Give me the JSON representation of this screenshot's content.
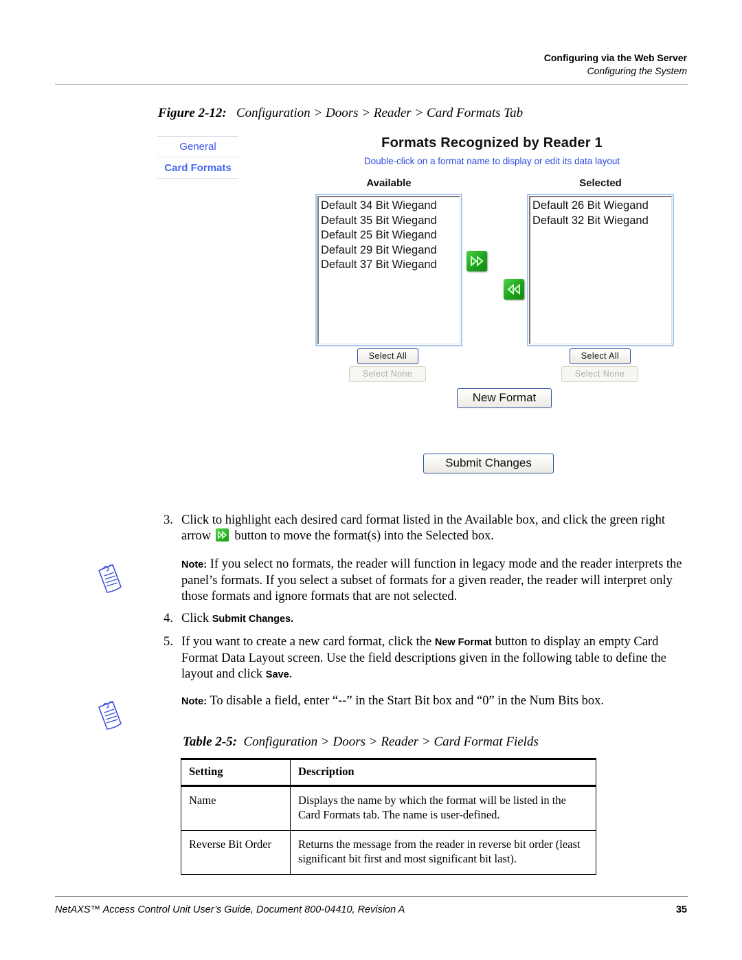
{
  "header": {
    "section": "Configuring via the Web Server",
    "subsection": "Configuring the System"
  },
  "figure": {
    "label": "Figure 2-12:",
    "caption": "Configuration > Doors > Reader > Card Formats Tab"
  },
  "screenshot": {
    "tabs": [
      {
        "label": "General",
        "active": false
      },
      {
        "label": "Card Formats",
        "active": true
      }
    ],
    "title": "Formats Recognized by Reader 1",
    "hint": "Double-click on a format name to display or edit its data layout",
    "available": {
      "heading": "Available",
      "items": [
        "Default 34 Bit Wiegand",
        "Default 35 Bit Wiegand",
        "Default 25 Bit Wiegand",
        "Default 29 Bit Wiegand",
        "Default 37 Bit Wiegand"
      ],
      "select_all": "Select All",
      "select_none": "Select None"
    },
    "selected": {
      "heading": "Selected",
      "items": [
        "Default 26 Bit Wiegand",
        "Default 32 Bit Wiegand"
      ],
      "select_all": "Select All",
      "select_none": "Select None"
    },
    "add_icon": "double-right-arrow-icon",
    "remove_icon": "double-left-arrow-icon",
    "new_format": "New Format",
    "submit": "Submit Changes",
    "accent_color": "#2a48e0",
    "arrow_color": "#1ea21c"
  },
  "steps": {
    "s3": {
      "num": "3.",
      "text_a": "Click to highlight each desired card format listed in the Available box, and click the green right arrow",
      "text_b": "button to move the format(s) into the Selected box."
    },
    "note1": {
      "label": "Note:",
      "text": "If you select no formats, the reader will function in legacy mode and the reader interprets the panel’s formats. If you select a subset of formats for a given reader, the reader will interpret only those formats and ignore formats that are not selected."
    },
    "s4": {
      "num": "4.",
      "text": "Click",
      "ref": "Submit Changes."
    },
    "s5": {
      "num": "5.",
      "text_a": "If you want to create a new card format, click the",
      "ref_a": "New Format",
      "text_b": "button to display an empty Card Format Data Layout screen. Use the field descriptions given in the following table to define the layout and click",
      "ref_b": "Save",
      "text_c": "."
    },
    "note2": {
      "label": "Note:",
      "text": "To disable a field, enter “--” in the Start Bit box and “0” in the Num Bits box."
    }
  },
  "table": {
    "label": "Table 2-5:",
    "caption": "Configuration > Doors > Reader > Card Format Fields",
    "headers": [
      "Setting",
      "Description"
    ],
    "rows": [
      [
        "Name",
        "Displays the name by which the format will be listed in the Card Formats tab. The name is user-defined."
      ],
      [
        "Reverse Bit Order",
        "Returns the message from the reader in reverse bit order (least significant bit first and most significant bit last)."
      ]
    ]
  },
  "footer": {
    "text": "NetAXS™ Access Control Unit User’s Guide, Document 800-04410, Revision A",
    "page": "35"
  }
}
